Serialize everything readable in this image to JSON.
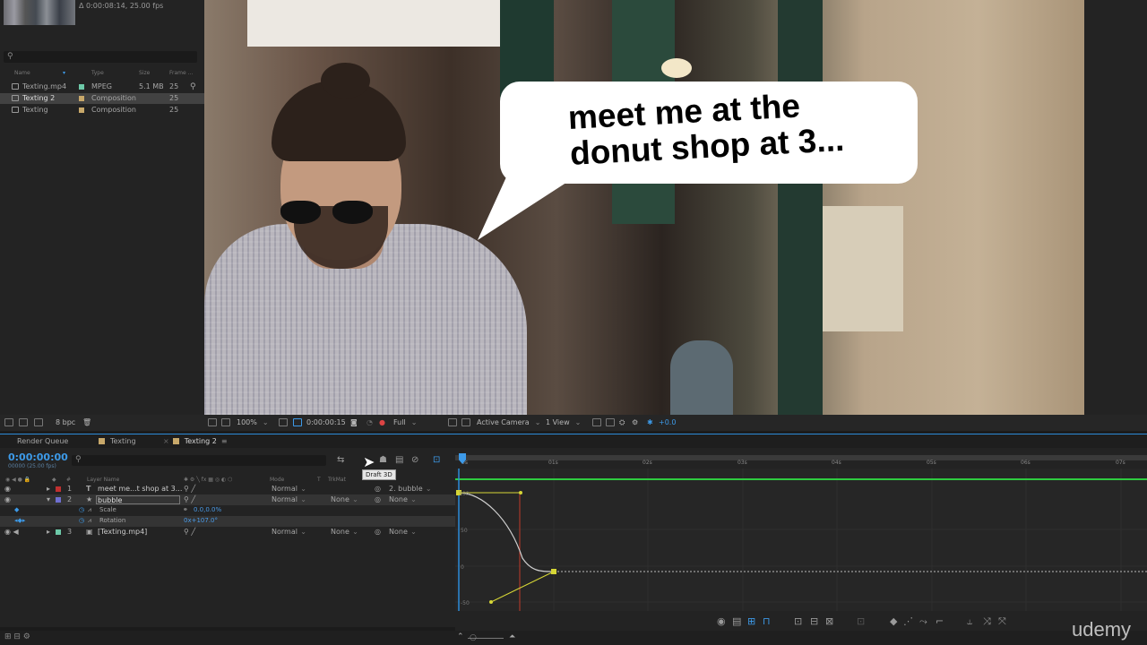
{
  "project": {
    "info": "Δ 0:00:08:14, 25.00 fps",
    "columns": {
      "name": "Name",
      "type": "Type",
      "size": "Size",
      "frame": "Frame ..."
    },
    "items": [
      {
        "name": "Texting.mp4",
        "type": "MPEG",
        "size": "5.1 MB",
        "frame": "25",
        "label_color": "#6dc9a8"
      },
      {
        "name": "Texting 2",
        "type": "Composition",
        "size": "",
        "frame": "25",
        "label_color": "#c8a86a"
      },
      {
        "name": "Texting",
        "type": "Composition",
        "size": "",
        "frame": "25",
        "label_color": "#c8a86a"
      }
    ]
  },
  "viewer": {
    "bubble_text": "meet me at the\ndonut shop at 3..."
  },
  "viewer_toolbar": {
    "bpc": "8 bpc",
    "zoom": "100%",
    "timecode": "0:00:00:15",
    "resolution": "Full",
    "camera": "Active Camera",
    "views": "1 View",
    "exposure": "+0.0"
  },
  "tabs": [
    {
      "label": "Render Queue"
    },
    {
      "label": "Texting",
      "color": "#c8a86a"
    },
    {
      "label": "Texting 2",
      "color": "#c8a86a",
      "active": true
    }
  ],
  "timeline": {
    "timecode": "0:00:00:00",
    "frame_sub": "00000 (25.00 fps)",
    "tooltip": "Draft 3D",
    "columns": {
      "layer_name": "Layer Name",
      "mode": "Mode",
      "t": "T",
      "trkmat": "TrkMat"
    },
    "layers": [
      {
        "num": "1",
        "name": "meet me...t shop at 3...",
        "mode": "Normal",
        "trkmat": "",
        "parent": "2. bubble",
        "color": "#c03030"
      },
      {
        "num": "2",
        "name": "bubble",
        "mode": "Normal",
        "trkmat": "None",
        "parent": "None",
        "color": "#6f6fd0"
      },
      {
        "num": "3",
        "name": "[Texting.mp4]",
        "mode": "Normal",
        "trkmat": "None",
        "parent": "None",
        "color": "#6dc9a8"
      }
    ],
    "props": [
      {
        "name": "Scale",
        "value": "0.0,0.0%"
      },
      {
        "name": "Rotation",
        "value": "0x+107.0°"
      }
    ]
  },
  "graph": {
    "ruler": [
      "0s",
      "01s",
      "02s",
      "03s",
      "04s",
      "05s",
      "06s",
      "07s"
    ],
    "y_labels": [
      "100",
      "50",
      "0",
      "-50"
    ]
  },
  "watermark": "udemy"
}
